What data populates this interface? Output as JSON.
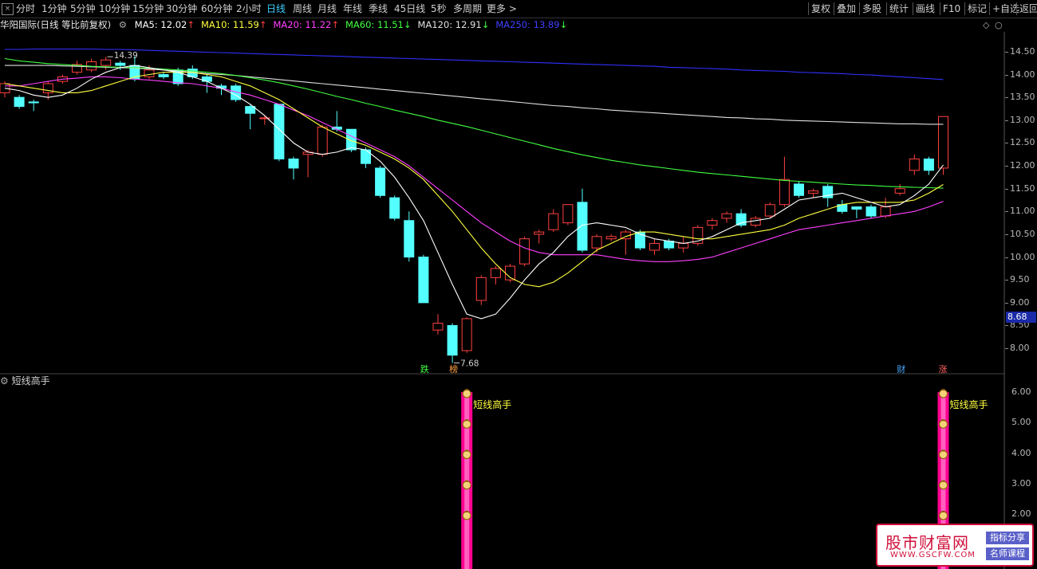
{
  "toolbar": {
    "left_items": [
      {
        "label": "分时",
        "active": false
      },
      {
        "label": "1分钟",
        "active": false
      },
      {
        "label": "5分钟",
        "active": false
      },
      {
        "label": "10分钟",
        "active": false
      },
      {
        "label": "15分钟",
        "active": false
      },
      {
        "label": "30分钟",
        "active": false
      },
      {
        "label": "60分钟",
        "active": false
      },
      {
        "label": "2小时",
        "active": false
      },
      {
        "label": "日线",
        "active": true
      },
      {
        "label": "周线",
        "active": false
      },
      {
        "label": "月线",
        "active": false
      },
      {
        "label": "年线",
        "active": false
      },
      {
        "label": "季线",
        "active": false
      },
      {
        "label": "45日线",
        "active": false
      },
      {
        "label": "5秒",
        "active": false
      },
      {
        "label": "多周期",
        "active": false
      },
      {
        "label": "更多 >",
        "active": false
      }
    ],
    "right_items": [
      "复权",
      "叠加",
      "多股",
      "统计",
      "画线",
      "F10",
      "标记",
      "+自选",
      "返回"
    ],
    "box_icon": "×"
  },
  "info": {
    "stock": "华阳国际(日线 等比前复权)",
    "ma": [
      {
        "label": "MA5: 12.02",
        "arrow": "↑",
        "color": "#ffffff",
        "arrow_color": "#ff4040"
      },
      {
        "label": "MA10: 11.59",
        "arrow": "↑",
        "color": "#ffff40",
        "arrow_color": "#ff4040"
      },
      {
        "label": "MA20: 11.22",
        "arrow": "↑",
        "color": "#ff40ff",
        "arrow_color": "#ff4040"
      },
      {
        "label": "MA60: 11.51",
        "arrow": "↓",
        "color": "#40ff40",
        "arrow_color": "#40ff40"
      },
      {
        "label": "MA120: 12.91",
        "arrow": "↓",
        "color": "#e0e0e0",
        "arrow_color": "#40ff40"
      },
      {
        "label": "MA250: 13.89",
        "arrow": "↓",
        "color": "#4040ff",
        "arrow_color": "#40ff40"
      }
    ]
  },
  "price_axis": {
    "ticks": [
      "14.50",
      "14.00",
      "13.50",
      "13.00",
      "12.50",
      "12.00",
      "11.50",
      "11.00",
      "10.50",
      "10.00",
      "9.50",
      "9.00",
      "8.50",
      "8.00"
    ],
    "current": "8.68"
  },
  "annotations": {
    "high": "14.39",
    "low": "7.68"
  },
  "markers": [
    {
      "text": "跌",
      "color": "#40ff40"
    },
    {
      "text": "榜",
      "color": "#ffa040"
    },
    {
      "text": "财",
      "color": "#4aa8ff"
    },
    {
      "text": "涨",
      "color": "#ff6060"
    }
  ],
  "subchart": {
    "title": "短线高手",
    "ticks": [
      "6.00",
      "5.00",
      "4.00",
      "3.00",
      "2.00"
    ],
    "signal_label": "短线高手",
    "signal_icon": "money-bag-icon"
  },
  "watermark": {
    "title": "股市财富网",
    "url": "WWW.GSCFW.COM",
    "tag1": "指标分享",
    "tag2": "名师课程"
  },
  "colors": {
    "up": "#ff4040",
    "down": "#54ffff",
    "ma5": "#ffffff",
    "ma10": "#ffff40",
    "ma20": "#ff40ff",
    "ma60": "#40ff40",
    "ma120": "#e0e0e0",
    "ma250": "#3030ff",
    "signal": "#ff0090"
  },
  "chart_data": {
    "type": "candlestick",
    "ylim": [
      7.6,
      14.9
    ],
    "candles": [
      [
        13.6,
        13.8,
        13.85,
        13.5
      ],
      [
        13.5,
        13.3,
        13.55,
        13.25
      ],
      [
        13.4,
        13.38,
        13.45,
        13.2
      ],
      [
        13.6,
        13.8,
        13.85,
        13.45
      ],
      [
        13.85,
        13.95,
        14.0,
        13.8
      ],
      [
        14.05,
        14.22,
        14.3,
        14.0
      ],
      [
        14.1,
        14.28,
        14.35,
        14.05
      ],
      [
        14.2,
        14.32,
        14.39,
        14.1
      ],
      [
        14.25,
        14.2,
        14.3,
        14.1
      ],
      [
        14.2,
        13.9,
        14.4,
        13.85
      ],
      [
        13.95,
        14.1,
        14.2,
        13.9
      ],
      [
        14.0,
        13.95,
        14.05,
        13.9
      ],
      [
        14.1,
        13.8,
        14.15,
        13.75
      ],
      [
        14.12,
        13.95,
        14.2,
        13.9
      ],
      [
        13.95,
        13.85,
        14.0,
        13.6
      ],
      [
        13.75,
        13.7,
        13.8,
        13.55
      ],
      [
        13.75,
        13.45,
        13.8,
        13.4
      ],
      [
        13.3,
        13.15,
        13.35,
        12.8
      ],
      [
        13.05,
        13.05,
        13.1,
        12.9
      ],
      [
        13.35,
        12.15,
        13.35,
        12.1
      ],
      [
        12.15,
        11.95,
        12.2,
        11.7
      ],
      [
        12.25,
        12.3,
        12.35,
        11.75
      ],
      [
        12.25,
        12.85,
        12.9,
        12.2
      ],
      [
        12.85,
        12.8,
        13.2,
        12.75
      ],
      [
        12.8,
        12.35,
        12.8,
        12.3
      ],
      [
        12.35,
        12.05,
        12.4,
        11.95
      ],
      [
        11.95,
        11.35,
        12.0,
        11.3
      ],
      [
        11.3,
        10.85,
        11.35,
        10.8
      ],
      [
        10.8,
        10.0,
        11.0,
        9.9
      ],
      [
        10.0,
        9.0,
        10.05,
        9.0
      ],
      [
        8.4,
        8.55,
        8.75,
        8.3
      ],
      [
        8.5,
        7.85,
        8.55,
        7.68
      ],
      [
        7.95,
        8.65,
        8.68,
        7.9
      ],
      [
        9.05,
        9.55,
        9.6,
        8.95
      ],
      [
        9.55,
        9.75,
        9.8,
        9.4
      ],
      [
        9.5,
        9.8,
        9.85,
        9.45
      ],
      [
        9.85,
        10.4,
        10.45,
        9.8
      ],
      [
        10.5,
        10.55,
        10.6,
        10.3
      ],
      [
        10.6,
        10.95,
        11.05,
        10.55
      ],
      [
        10.75,
        11.15,
        11.15,
        10.7
      ],
      [
        11.2,
        10.15,
        11.5,
        10.1
      ],
      [
        10.2,
        10.45,
        10.5,
        10.1
      ],
      [
        10.4,
        10.45,
        10.5,
        10.35
      ],
      [
        10.4,
        10.55,
        10.6,
        10.05
      ],
      [
        10.55,
        10.2,
        10.6,
        10.15
      ],
      [
        10.15,
        10.3,
        10.4,
        10.05
      ],
      [
        10.35,
        10.2,
        10.4,
        10.15
      ],
      [
        10.2,
        10.3,
        10.45,
        10.1
      ],
      [
        10.3,
        10.65,
        10.7,
        10.25
      ],
      [
        10.7,
        10.8,
        10.85,
        10.6
      ],
      [
        10.85,
        10.95,
        11.0,
        10.75
      ],
      [
        10.95,
        10.7,
        11.05,
        10.65
      ],
      [
        10.7,
        10.85,
        10.9,
        10.65
      ],
      [
        10.9,
        11.15,
        11.2,
        10.85
      ],
      [
        11.15,
        11.7,
        12.2,
        11.1
      ],
      [
        11.6,
        11.35,
        11.65,
        11.3
      ],
      [
        11.4,
        11.45,
        11.5,
        11.3
      ],
      [
        11.55,
        11.3,
        11.6,
        11.1
      ],
      [
        11.15,
        11.0,
        11.25,
        10.95
      ],
      [
        11.1,
        11.05,
        11.1,
        10.85
      ],
      [
        11.1,
        10.9,
        11.15,
        10.85
      ],
      [
        10.9,
        11.1,
        11.3,
        10.85
      ],
      [
        11.4,
        11.5,
        11.6,
        11.35
      ],
      [
        11.9,
        12.15,
        12.25,
        11.8
      ],
      [
        12.15,
        11.9,
        12.2,
        11.8
      ],
      [
        11.95,
        13.08,
        13.08,
        11.8
      ]
    ],
    "signal_bars": [
      32,
      65
    ],
    "series_ma5": [
      13.7,
      13.65,
      13.55,
      13.5,
      13.55,
      13.7,
      13.9,
      14.05,
      14.15,
      14.2,
      14.15,
      14.1,
      14.05,
      13.95,
      13.85,
      13.7,
      13.55,
      13.35,
      13.1,
      12.8,
      12.5,
      12.3,
      12.25,
      12.3,
      12.4,
      12.35,
      12.1,
      11.75,
      11.3,
      10.8,
      10.1,
      9.4,
      8.75,
      8.65,
      8.75,
      9.1,
      9.5,
      9.85,
      10.1,
      10.45,
      10.7,
      10.75,
      10.7,
      10.65,
      10.5,
      10.4,
      10.35,
      10.3,
      10.35,
      10.45,
      10.6,
      10.75,
      10.8,
      10.85,
      11.05,
      11.25,
      11.3,
      11.35,
      11.4,
      11.3,
      11.2,
      11.1,
      11.15,
      11.35,
      11.6,
      12.02
    ],
    "series_ma10": [
      13.8,
      13.75,
      13.7,
      13.65,
      13.6,
      13.6,
      13.65,
      13.75,
      13.85,
      13.95,
      14.0,
      14.05,
      14.05,
      14.05,
      14.0,
      13.95,
      13.85,
      13.75,
      13.6,
      13.45,
      13.25,
      13.05,
      12.85,
      12.7,
      12.55,
      12.45,
      12.3,
      12.15,
      11.95,
      11.7,
      11.35,
      11.0,
      10.6,
      10.2,
      9.85,
      9.55,
      9.4,
      9.35,
      9.45,
      9.65,
      9.9,
      10.15,
      10.3,
      10.45,
      10.55,
      10.55,
      10.5,
      10.45,
      10.4,
      10.4,
      10.45,
      10.5,
      10.55,
      10.6,
      10.7,
      10.85,
      10.95,
      11.05,
      11.15,
      11.2,
      11.2,
      11.2,
      11.2,
      11.25,
      11.4,
      11.59
    ],
    "series_ma20": [
      13.75,
      13.75,
      13.8,
      13.85,
      13.9,
      13.92,
      13.95,
      13.95,
      13.93,
      13.9,
      13.88,
      13.85,
      13.82,
      13.8,
      13.75,
      13.7,
      13.62,
      13.55,
      13.45,
      13.35,
      13.22,
      13.1,
      12.95,
      12.8,
      12.65,
      12.5,
      12.35,
      12.2,
      12.0,
      11.75,
      11.5,
      11.25,
      11.0,
      10.75,
      10.55,
      10.35,
      10.2,
      10.1,
      10.05,
      10.05,
      10.05,
      10.05,
      10.0,
      9.95,
      9.92,
      9.9,
      9.9,
      9.92,
      9.95,
      10.0,
      10.1,
      10.2,
      10.3,
      10.4,
      10.5,
      10.6,
      10.65,
      10.7,
      10.75,
      10.8,
      10.85,
      10.9,
      10.95,
      11.0,
      11.1,
      11.22
    ],
    "series_ma60": [
      14.35,
      14.3,
      14.27,
      14.24,
      14.22,
      14.2,
      14.18,
      14.17,
      14.16,
      14.15,
      14.14,
      14.12,
      14.1,
      14.08,
      14.05,
      14.02,
      13.98,
      13.93,
      13.88,
      13.82,
      13.75,
      13.68,
      13.6,
      13.52,
      13.45,
      13.37,
      13.3,
      13.22,
      13.15,
      13.08,
      13.0,
      12.93,
      12.86,
      12.78,
      12.7,
      12.62,
      12.54,
      12.46,
      12.38,
      12.31,
      12.24,
      12.18,
      12.12,
      12.07,
      12.02,
      11.98,
      11.94,
      11.9,
      11.86,
      11.83,
      11.8,
      11.77,
      11.74,
      11.71,
      11.68,
      11.66,
      11.64,
      11.62,
      11.6,
      11.58,
      11.57,
      11.55,
      11.54,
      11.53,
      11.52,
      11.51
    ],
    "series_ma120": [
      14.2,
      14.2,
      14.2,
      14.2,
      14.19,
      14.18,
      14.17,
      14.16,
      14.15,
      14.14,
      14.12,
      14.1,
      14.08,
      14.05,
      14.02,
      14.0,
      13.98,
      13.95,
      13.92,
      13.89,
      13.86,
      13.83,
      13.8,
      13.77,
      13.74,
      13.71,
      13.68,
      13.65,
      13.62,
      13.59,
      13.56,
      13.53,
      13.5,
      13.47,
      13.44,
      13.41,
      13.38,
      13.35,
      13.32,
      13.3,
      13.27,
      13.25,
      13.22,
      13.2,
      13.18,
      13.16,
      13.14,
      13.12,
      13.1,
      13.08,
      13.06,
      13.05,
      13.03,
      13.02,
      13.0,
      12.99,
      12.98,
      12.97,
      12.96,
      12.95,
      12.94,
      12.93,
      12.92,
      12.92,
      12.91,
      12.91
    ],
    "series_ma250": [
      14.55,
      14.55,
      14.56,
      14.56,
      14.56,
      14.56,
      14.56,
      14.55,
      14.55,
      14.54,
      14.53,
      14.52,
      14.51,
      14.5,
      14.49,
      14.48,
      14.47,
      14.46,
      14.45,
      14.44,
      14.43,
      14.42,
      14.41,
      14.4,
      14.39,
      14.38,
      14.37,
      14.36,
      14.35,
      14.34,
      14.33,
      14.32,
      14.31,
      14.3,
      14.29,
      14.28,
      14.27,
      14.26,
      14.25,
      14.24,
      14.23,
      14.22,
      14.21,
      14.2,
      14.19,
      14.18,
      14.16,
      14.15,
      14.14,
      14.13,
      14.12,
      14.1,
      14.09,
      14.08,
      14.07,
      14.05,
      14.04,
      14.03,
      14.02,
      14.0,
      13.99,
      13.97,
      13.95,
      13.93,
      13.91,
      13.89
    ]
  }
}
